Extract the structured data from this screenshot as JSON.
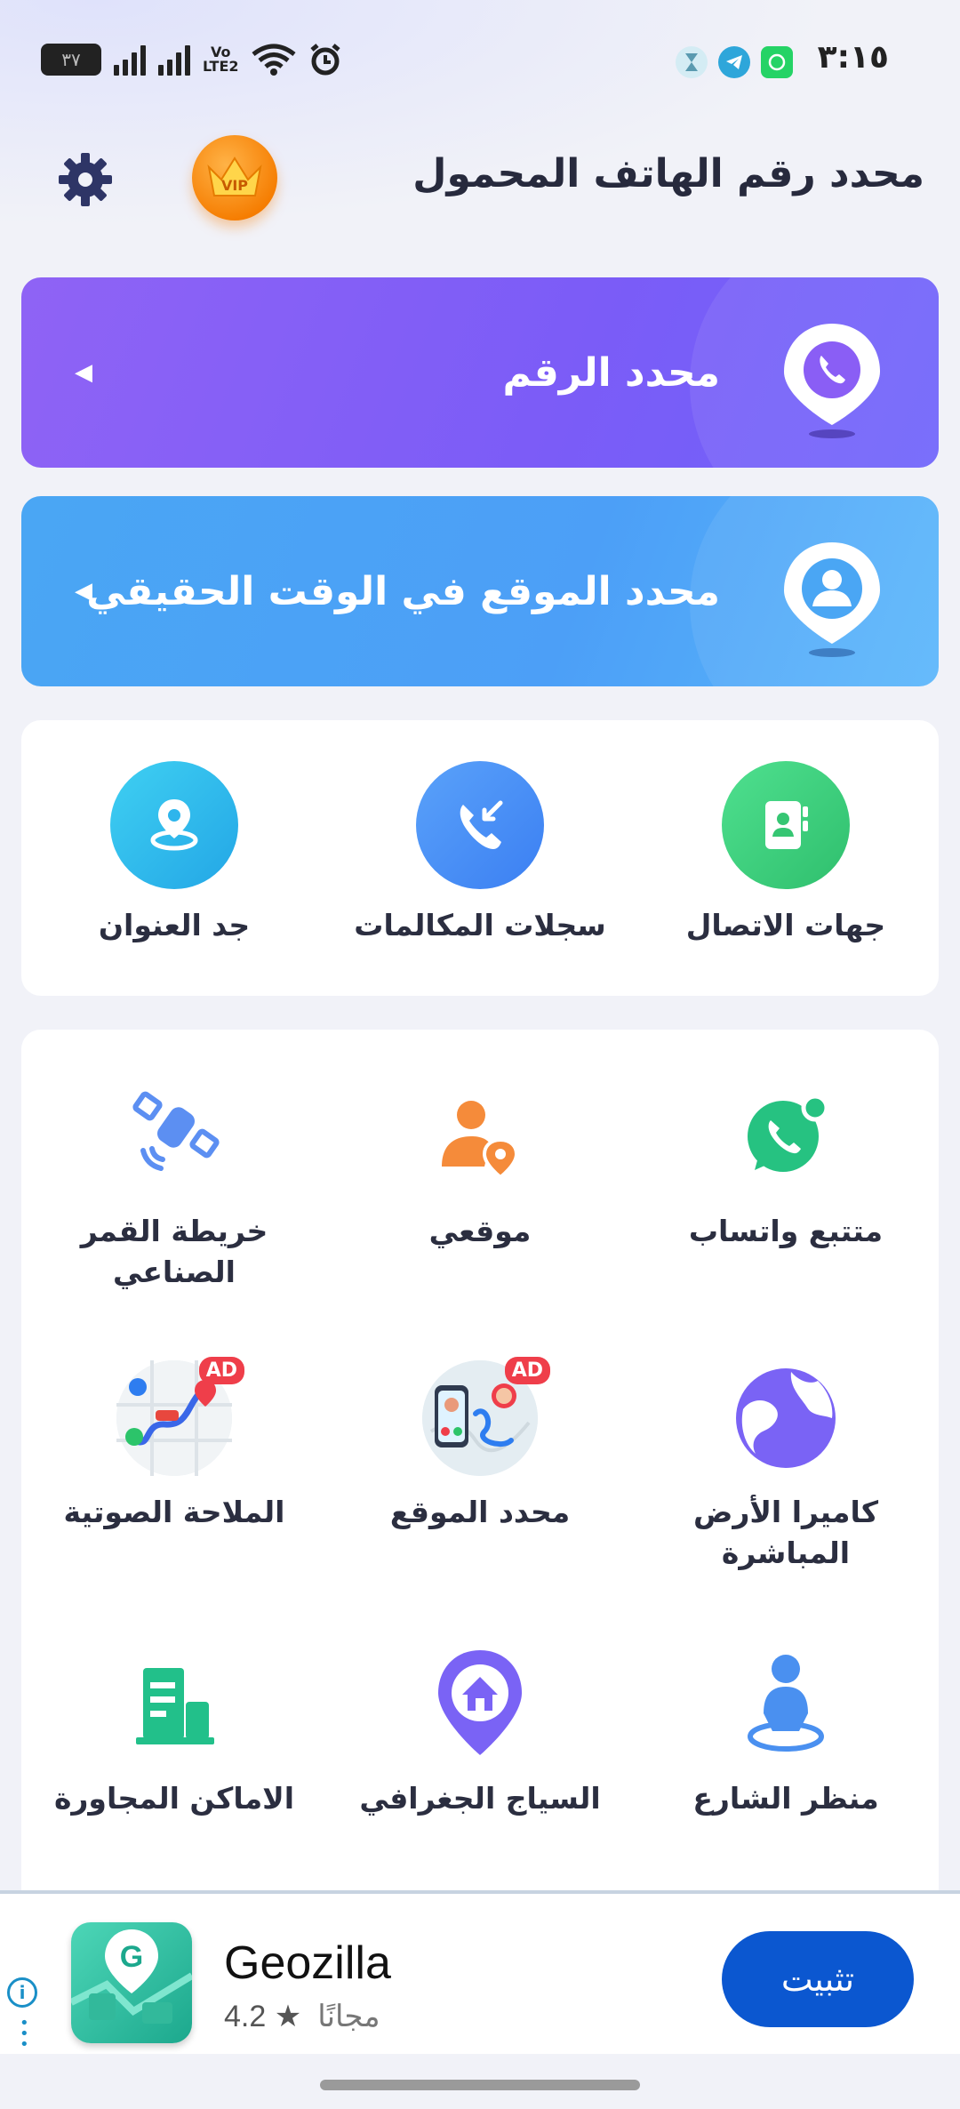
{
  "status_bar": {
    "time": "٣:١٥",
    "battery": "٣٧",
    "volte_top": "Vo",
    "volte_bottom": "LTE2"
  },
  "header": {
    "title": "محدد رقم الهاتف المحمول",
    "vip_label": "VIP"
  },
  "banners": [
    {
      "label": "محدد الرقم",
      "icon": "phone-location-pin-icon"
    },
    {
      "label": "محدد الموقع في الوقت الحقيقي",
      "icon": "person-location-pin-icon"
    }
  ],
  "quick_tools": [
    {
      "label": "جهات الاتصال",
      "icon": "contacts-icon",
      "color": "#3ecf7e"
    },
    {
      "label": "سجلات المكالمات",
      "icon": "call-log-icon",
      "color": "#4a8df6"
    },
    {
      "label": "جد العنوان",
      "icon": "address-pin-icon",
      "color": "#2cbfe8"
    }
  ],
  "tools": [
    {
      "label": "متتبع واتساب",
      "icon": "whatsapp-icon"
    },
    {
      "label": "موقعي",
      "icon": "my-location-person-icon"
    },
    {
      "label": "خريطة القمر الصناعي",
      "icon": "satellite-icon"
    },
    {
      "label": "كاميرا الأرض المباشرة",
      "icon": "earth-globe-icon"
    },
    {
      "label": "محدد الموقع",
      "icon": "location-finder-ad-icon",
      "badge": "AD"
    },
    {
      "label": "الملاحة الصوتية",
      "icon": "voice-navigation-ad-icon",
      "badge": "AD"
    },
    {
      "label": "منظر الشارع",
      "icon": "street-view-icon"
    },
    {
      "label": "السياج الجغرافي",
      "icon": "geofence-home-icon"
    },
    {
      "label": "الاماكن المجاورة",
      "icon": "nearby-buildings-icon"
    }
  ],
  "ad": {
    "app_name": "Geozilla",
    "rating": "4.2 ★",
    "price": "مجانًا",
    "install_label": "تثبيت",
    "info": "i"
  },
  "colors": {
    "banner1": "#7b5cf7",
    "banner2": "#4c9ff7",
    "install": "#0b57d0"
  }
}
